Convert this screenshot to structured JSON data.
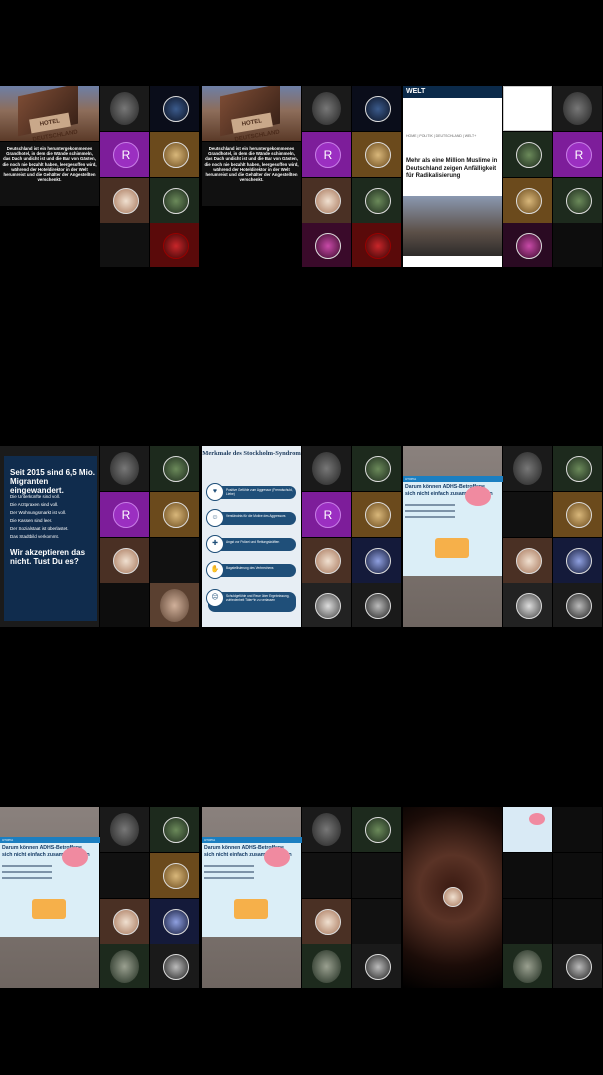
{
  "hotel_post": {
    "sign": "HOTEL DEUTSCHLAND",
    "text": "Deutschland ist ein heruntergekommenes Grandhotel, in dem die Wände schimmeln, das Dach undicht ist und die Bar von Gästen, die noch nie bezahlt haben, leergesoffen wird, während der Hoteldirektor in der Welt herumreist und die Gehälter der Angestellten verschenkt."
  },
  "welt_post": {
    "logo": "WELT",
    "breadcrumb": "HOME | POLITIK | DEUTSCHLAND | WELT+",
    "headline": "Mehr als eine Million Muslime in Deutschland zeigen Anfälligkeit für Radikalisierung"
  },
  "migranten_post": {
    "heading": "Seit 2015 sind 6,5 Mio. Migranten eingewandert.",
    "items": [
      "Die Unterkünfte sind voll.",
      "Die Arztpraxen sind voll.",
      "Der Wohnungsmarkt ist voll.",
      "Die Kassen sind leer.",
      "Der Sozialstaat ist überlastet.",
      "Das Stadtbild verkommt."
    ],
    "footer": "Wir akzeptieren das nicht. Tust Du es?"
  },
  "stockholm_post": {
    "title": "Merkmale des Stockholm-Syndrom",
    "items": [
      "Positive Gefühle zum Aggressor (Fremdschuld, Liebe)",
      "Verständnis für die Motive des Aggressors",
      "Angst vor Polizei und Rettungskräften",
      "Bagatellisierung des Verbrechens",
      "Schuldgefühle und Reue über Ergebnissung, zufriedenheit Täter*in zu verlassen"
    ]
  },
  "adhs_post": {
    "top_label": "UTOPIA",
    "title_line1": "Darum können ADHS-Betroffene",
    "title_line2": "sich nicht einfach zusammenreißen"
  },
  "avatar_letter": "R"
}
